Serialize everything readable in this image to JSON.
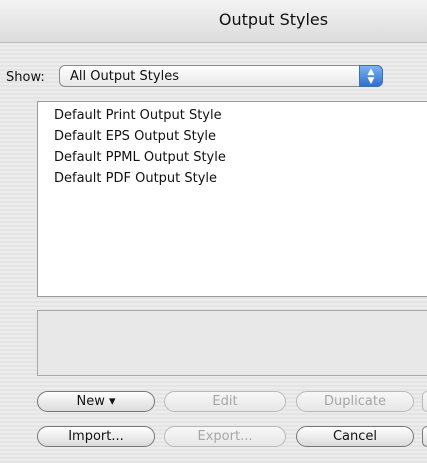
{
  "window": {
    "title": "Output Styles"
  },
  "filter": {
    "label": "Show:",
    "selected": "All Output Styles"
  },
  "styles_list": {
    "items": [
      "Default Print Output Style",
      "Default EPS Output Style",
      "Default PPML Output Style",
      "Default PDF Output Style"
    ]
  },
  "buttons": {
    "new": "New",
    "new_arrow": "▾",
    "edit": "Edit",
    "duplicate": "Duplicate",
    "import": "Import...",
    "export": "Export...",
    "cancel": "Cancel"
  },
  "icons": {
    "popup_arrows": "up-down-arrows-icon",
    "new_menu": "dropdown-triangle-icon"
  }
}
